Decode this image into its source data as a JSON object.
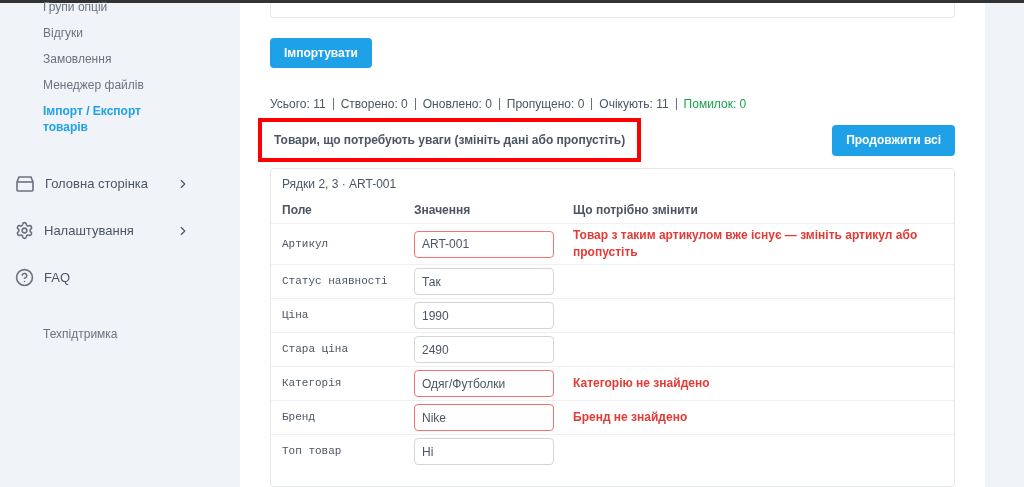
{
  "sidebar": {
    "items": [
      {
        "label": "Групи опцій",
        "selected": false,
        "kind": "sub"
      },
      {
        "label": "Відгуки",
        "selected": false,
        "kind": "sub"
      },
      {
        "label": "Замовлення",
        "selected": false,
        "kind": "sub"
      },
      {
        "label": "Менеджер файлів",
        "selected": false,
        "kind": "sub"
      },
      {
        "label": "Імпорт / Експорт товарів",
        "selected": true,
        "kind": "sub"
      },
      {
        "label": "Головна сторінка",
        "kind": "tray",
        "expandable": true
      },
      {
        "label": "Налаштування",
        "kind": "gear",
        "expandable": true
      },
      {
        "label": "FAQ",
        "kind": "help",
        "expandable": false
      },
      {
        "label": "Техпідтримка",
        "kind": "sub",
        "selected": false
      }
    ]
  },
  "import_button": "Імпортувати",
  "stats": [
    {
      "text": "Усього: 11",
      "color": "#4b5563"
    },
    {
      "text": "Створено: 0",
      "color": "#4b5563"
    },
    {
      "text": "Оновлено: 0",
      "color": "#4b5563"
    },
    {
      "text": "Пропущено: 0",
      "color": "#4b5563"
    },
    {
      "text": "Очікують: 11",
      "color": "#4b5563"
    },
    {
      "text": "Помилок: 0",
      "color": "#16a34a"
    }
  ],
  "attention": {
    "heading": "Товари, що потребують уваги (змініть дані або пропустіть)",
    "highlighted": true,
    "continue_button": "Продовжити всі"
  },
  "card": {
    "title": "Рядки 2, 3 · ART-001",
    "columns": [
      "Поле",
      "Значення",
      "Що потрібно змінити"
    ],
    "rows": [
      {
        "field": "Артикул",
        "value": "ART-001",
        "invalid": true,
        "message": "Товар з таким артикулом вже існує — змініть артикул або пропустіть"
      },
      {
        "field": "Статус наявності",
        "value": "Так",
        "invalid": false
      },
      {
        "field": "Ціна",
        "value": "1990",
        "invalid": false
      },
      {
        "field": "Стара ціна",
        "value": "2490",
        "invalid": false
      },
      {
        "field": "Категорія",
        "value": "Одяг/Футболки",
        "invalid": true,
        "message": "Категорію не знайдено"
      },
      {
        "field": "Бренд",
        "value": "Nike",
        "invalid": true,
        "message": "Бренд не знайдено"
      },
      {
        "field": "Топ товар",
        "value": "Ні",
        "invalid": false
      }
    ]
  }
}
